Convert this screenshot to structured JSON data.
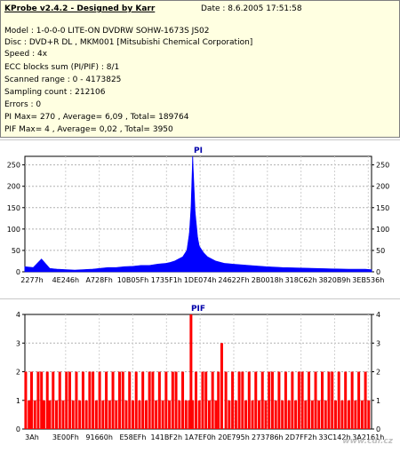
{
  "report": {
    "title": "KProbe v2.4.2 - Designed by Karr",
    "date": "Date : 8.6.2005 17:51:58",
    "lines": [
      "Model : 1-0-0-0 LITE-ON DVDRW SOHW-1673S JS02",
      "Disc : DVD+R DL , MKM001 [Mitsubishi Chemical Corporation]",
      "Speed : 4x",
      "ECC blocks sum (PI/PIF) : 8/1",
      "Scanned range : 0 - 4173825",
      "Sampling count : 212106",
      "Errors : 0",
      "PI Max= 270 , Average= 6,09 , Total= 189764",
      "PIF Max= 4 , Average= 0,02 , Total= 3950"
    ]
  },
  "chart_data": [
    {
      "type": "area",
      "title": "PI",
      "color": "#0000ff",
      "ylim": [
        0,
        270
      ],
      "yticks": [
        0,
        50,
        100,
        150,
        200,
        250
      ],
      "grid": true,
      "xlim": [
        0,
        4173825
      ],
      "xtick_labels": [
        "2277h",
        "4E246h",
        "A728Fh",
        "10B05Fh",
        "1735F1h",
        "1DE074h",
        "24622Fh",
        "2B0018h",
        "318C62h",
        "3820B9h",
        "3EB536h"
      ],
      "x": [
        0,
        100000,
        200000,
        300000,
        400000,
        500000,
        600000,
        700000,
        800000,
        900000,
        1000000,
        1100000,
        1200000,
        1300000,
        1400000,
        1500000,
        1600000,
        1700000,
        1750000,
        1800000,
        1850000,
        1900000,
        1950000,
        1980000,
        2000000,
        2020000,
        2050000,
        2080000,
        2100000,
        2150000,
        2200000,
        2300000,
        2400000,
        2500000,
        2700000,
        2900000,
        3100000,
        3300000,
        3500000,
        3700000,
        3900000,
        4100000,
        4173825
      ],
      "values": [
        12,
        10,
        30,
        8,
        6,
        5,
        4,
        5,
        6,
        8,
        10,
        10,
        12,
        13,
        15,
        15,
        18,
        20,
        22,
        25,
        30,
        35,
        50,
        90,
        150,
        270,
        140,
        80,
        60,
        45,
        35,
        25,
        20,
        18,
        15,
        12,
        10,
        9,
        8,
        7,
        6,
        6,
        5
      ]
    },
    {
      "type": "bar",
      "title": "PIF",
      "color": "#ff0000",
      "ylim": [
        0,
        4
      ],
      "yticks": [
        0,
        1,
        2,
        3,
        4
      ],
      "grid": true,
      "xlim": [
        0,
        4173825
      ],
      "xtick_labels": [
        "3Ah",
        "3E00Fh",
        "91660h",
        "E58EFh",
        "141BF2h",
        "1A7EF0h",
        "20E795h",
        "273786h",
        "2D7FF2h",
        "33C142h",
        "3A2161h"
      ],
      "x": [
        10000,
        50000,
        80000,
        120000,
        160000,
        200000,
        230000,
        270000,
        300000,
        340000,
        380000,
        420000,
        460000,
        500000,
        540000,
        580000,
        620000,
        660000,
        700000,
        740000,
        780000,
        820000,
        860000,
        900000,
        940000,
        980000,
        1020000,
        1060000,
        1100000,
        1140000,
        1180000,
        1220000,
        1260000,
        1300000,
        1340000,
        1380000,
        1420000,
        1460000,
        1500000,
        1540000,
        1580000,
        1620000,
        1660000,
        1700000,
        1740000,
        1780000,
        1820000,
        1860000,
        1900000,
        1940000,
        1980000,
        2000000,
        2020000,
        2060000,
        2100000,
        2140000,
        2180000,
        2220000,
        2260000,
        2300000,
        2330000,
        2370000,
        2420000,
        2460000,
        2500000,
        2540000,
        2580000,
        2620000,
        2660000,
        2700000,
        2740000,
        2780000,
        2820000,
        2860000,
        2900000,
        2940000,
        2980000,
        3020000,
        3060000,
        3100000,
        3140000,
        3180000,
        3220000,
        3260000,
        3300000,
        3340000,
        3380000,
        3420000,
        3460000,
        3500000,
        3540000,
        3580000,
        3620000,
        3660000,
        3700000,
        3740000,
        3780000,
        3820000,
        3860000,
        3900000,
        3940000,
        3980000,
        4020000,
        4060000,
        4100000,
        4140000
      ],
      "values": [
        2,
        1,
        2,
        1,
        2,
        2,
        1,
        2,
        1,
        2,
        1,
        2,
        1,
        2,
        2,
        1,
        2,
        1,
        2,
        1,
        2,
        2,
        1,
        2,
        1,
        2,
        1,
        2,
        1,
        2,
        2,
        1,
        2,
        1,
        2,
        1,
        2,
        1,
        2,
        2,
        1,
        2,
        1,
        2,
        1,
        2,
        2,
        1,
        2,
        1,
        1,
        4,
        1,
        2,
        1,
        2,
        2,
        1,
        2,
        1,
        2,
        3,
        2,
        1,
        2,
        1,
        2,
        2,
        1,
        2,
        1,
        2,
        1,
        2,
        1,
        2,
        2,
        1,
        2,
        1,
        2,
        1,
        2,
        1,
        2,
        2,
        1,
        2,
        1,
        2,
        1,
        2,
        1,
        2,
        2,
        1,
        2,
        1,
        2,
        1,
        2,
        1,
        2,
        1,
        2,
        1,
        2
      ]
    }
  ],
  "watermark": "www.cdr.cz"
}
